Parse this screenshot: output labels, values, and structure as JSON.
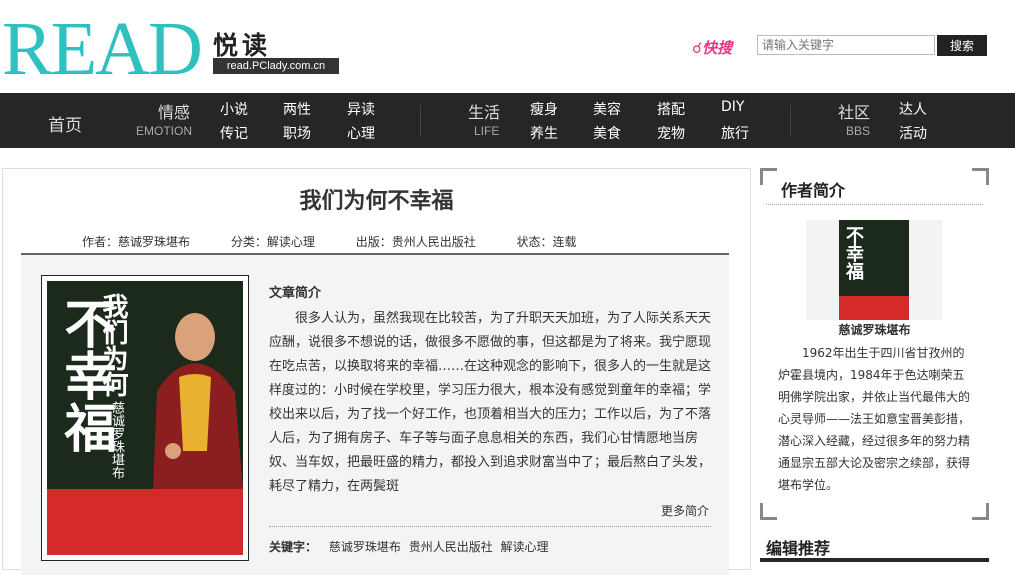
{
  "header": {
    "logo_text": "READ",
    "logo_cn": "悦读",
    "logo_url": "read.PClady.com.cn",
    "quick_search": "快搜",
    "search_placeholder": "请输入关键字",
    "search_button": "搜索"
  },
  "nav": {
    "home": "首页",
    "emotion_cn": "情感",
    "emotion_en": "EMOTION",
    "emotion_links": [
      "小说",
      "两性",
      "异读",
      "传记",
      "职场",
      "心理"
    ],
    "life_cn": "生活",
    "life_en": "LIFE",
    "life_links": [
      "瘦身",
      "美容",
      "搭配",
      "DIY",
      "养生",
      "美食",
      "宠物",
      "旅行"
    ],
    "bbs_cn": "社区",
    "bbs_en": "BBS",
    "bbs_links": [
      "达人",
      "活动"
    ]
  },
  "book": {
    "title": "我们为何不幸福",
    "author": "作者：慈诚罗珠堪布",
    "category": "分类：解读心理",
    "publisher": "出版：贵州人民出版社",
    "status": "状态：连载",
    "cover_title_small": "我们为何",
    "cover_title_big": "不幸福",
    "cover_author": "慈诚罗珠堪布",
    "intro_heading": "文章简介",
    "intro": "很多人认为，虽然我现在比较苦，为了升职天天加班，为了人际关系天天应酬，说很多不想说的话，做很多不愿做的事，但这都是为了将来。我宁愿现在吃点苦，以换取将来的幸福……在这种观念的影响下，很多人的一生就是这样度过的：小时候在学校里，学习压力很大，根本没有感觉到童年的幸福；学校出来以后，为了找一个好工作，也顶着相当大的压力；工作以后，为了不落人后，为了拥有房子、车子等与面子息息相关的东西，我们心甘情愿地当房奴、当车奴，把最旺盛的精力，都投入到追求财富当中了；最后熬白了头发，耗尽了精力，在两鬓斑",
    "more": "更多简介",
    "keywords_label": "关键字：",
    "keywords": [
      "慈诚罗珠堪布",
      "贵州人民出版社",
      "解读心理"
    ]
  },
  "side": {
    "heading": "作者简介",
    "cover_text": "不幸福",
    "author_name": "慈诚罗珠堪布",
    "bio": "1962年出生于四川省甘孜州的炉霍县境内，1984年于色达喇荣五明佛学院出家，并依止当代最伟大的心灵导师——法王如意宝晋美彭措，潜心深入经藏，经过很多年的努力精通显宗五部大论及密宗之续部，获得堪布学位。",
    "editor_heading": "编辑推荐"
  },
  "colors": {
    "logo": "#2fc1c0",
    "nav_bg": "#262626",
    "quick_search": "#e8387f",
    "cover_red": "#d42a2a"
  }
}
